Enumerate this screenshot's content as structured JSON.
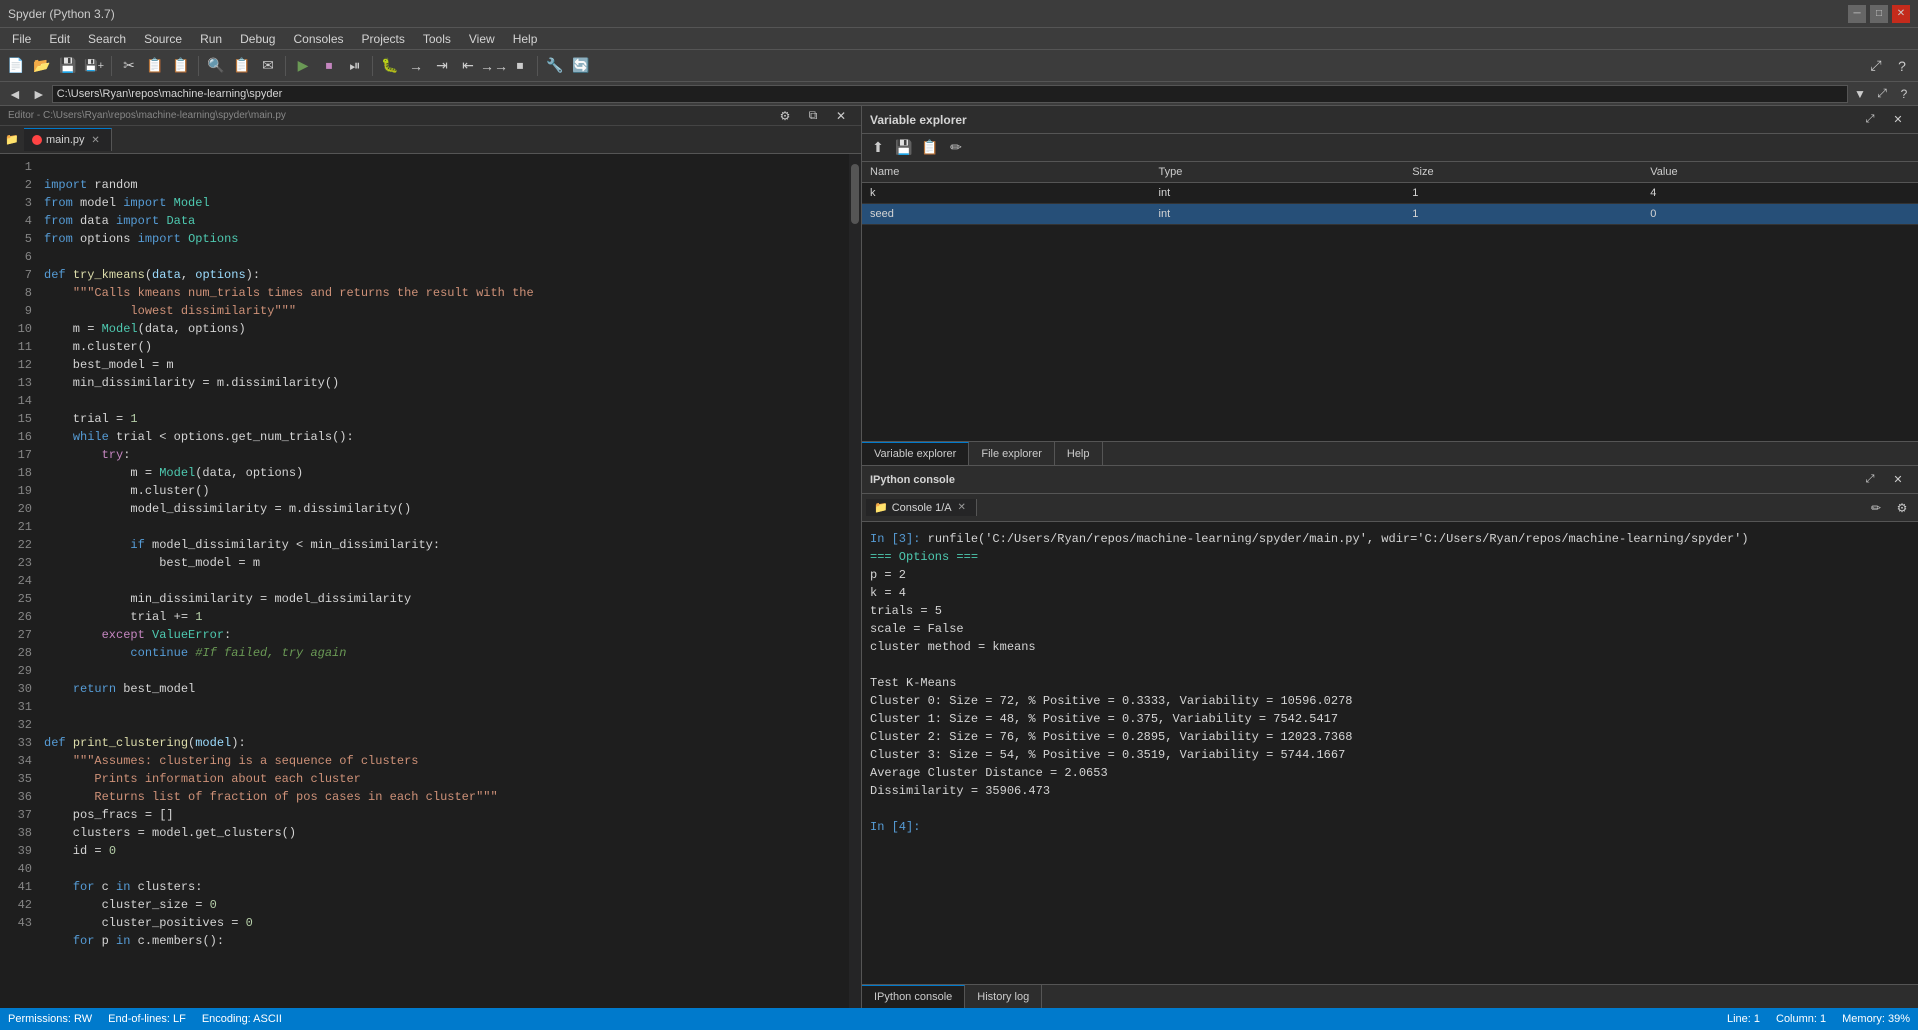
{
  "titleBar": {
    "title": "Spyder (Python 3.7)",
    "minimizeLabel": "─",
    "maximizeLabel": "□",
    "closeLabel": "✕"
  },
  "menuBar": {
    "items": [
      "File",
      "Edit",
      "Search",
      "Source",
      "Run",
      "Debug",
      "Consoles",
      "Projects",
      "Tools",
      "View",
      "Help"
    ]
  },
  "toolbar": {
    "buttons": [
      "📄",
      "📂",
      "💾",
      "✂",
      "📋",
      "📋",
      "🔍",
      "📋",
      "✉",
      "▶",
      "⏹",
      "⏯",
      "⏭",
      "🔧",
      "↺",
      "→",
      "⇥",
      "⇤",
      "→→",
      "⏹",
      "⏸",
      "◼",
      "🔧",
      "🔄"
    ]
  },
  "navBar": {
    "backLabel": "◄",
    "forwardLabel": "►",
    "path": "C:\\Users\\Ryan\\repos\\machine-learning\\spyder",
    "browseLabel": "▼"
  },
  "editor": {
    "headerLeft": "Editor - C:\\Users\\Ryan\\repos\\machine-learning\\spyder\\main.py",
    "tabs": [
      {
        "name": "main.py",
        "active": true,
        "modified": true
      }
    ],
    "gearIcon": "⚙",
    "closeIcon": "✕",
    "lines": [
      {
        "num": 1,
        "text": "import random"
      },
      {
        "num": 2,
        "text": "from model import Model"
      },
      {
        "num": 3,
        "text": "from data import Data"
      },
      {
        "num": 4,
        "text": "from options import Options"
      },
      {
        "num": 5,
        "text": ""
      },
      {
        "num": 6,
        "text": "def try_kmeans(data, options):"
      },
      {
        "num": 7,
        "text": "    \"\"\"Calls kmeans num_trials times and returns the result with the"
      },
      {
        "num": 8,
        "text": "            lowest dissimilarity\"\"\""
      },
      {
        "num": 9,
        "text": "    m = Model(data, options)"
      },
      {
        "num": 10,
        "text": "    m.cluster()"
      },
      {
        "num": 11,
        "text": "    best_model = m"
      },
      {
        "num": 12,
        "text": "    min_dissimilarity = m.dissimilarity()"
      },
      {
        "num": 13,
        "text": ""
      },
      {
        "num": 14,
        "text": "    trial = 1"
      },
      {
        "num": 15,
        "text": "    while trial < options.get_num_trials():"
      },
      {
        "num": 16,
        "text": "        try:"
      },
      {
        "num": 17,
        "text": "            m = Model(data, options)"
      },
      {
        "num": 18,
        "text": "            m.cluster()"
      },
      {
        "num": 19,
        "text": "            model_dissimilarity = m.dissimilarity()"
      },
      {
        "num": 20,
        "text": ""
      },
      {
        "num": 21,
        "text": "            if model_dissimilarity < min_dissimilarity:"
      },
      {
        "num": 22,
        "text": "                best_model = m"
      },
      {
        "num": 23,
        "text": ""
      },
      {
        "num": 24,
        "text": "            min_dissimilarity = model_dissimilarity"
      },
      {
        "num": 25,
        "text": "            trial += 1"
      },
      {
        "num": 26,
        "text": "        except ValueError:"
      },
      {
        "num": 27,
        "text": "            continue #If failed, try again"
      },
      {
        "num": 28,
        "text": ""
      },
      {
        "num": 29,
        "text": "    return best_model"
      },
      {
        "num": 30,
        "text": ""
      },
      {
        "num": 31,
        "text": ""
      },
      {
        "num": 32,
        "text": "def print_clustering(model):"
      },
      {
        "num": 33,
        "text": "    \"\"\"Assumes: clustering is a sequence of clusters"
      },
      {
        "num": 34,
        "text": "       Prints information about each cluster"
      },
      {
        "num": 35,
        "text": "       Returns list of fraction of pos cases in each cluster\"\"\""
      },
      {
        "num": 36,
        "text": "    pos_fracs = []"
      },
      {
        "num": 37,
        "text": "    clusters = model.get_clusters()"
      },
      {
        "num": 38,
        "text": "    id = 0"
      },
      {
        "num": 39,
        "text": ""
      },
      {
        "num": 40,
        "text": "    for c in clusters:"
      },
      {
        "num": 41,
        "text": "        cluster_size = 0"
      },
      {
        "num": 42,
        "text": "        cluster_positives = 0"
      },
      {
        "num": 43,
        "text": "    for p in c.members():"
      }
    ]
  },
  "variableExplorer": {
    "title": "Variable explorer",
    "gearIcon": "⚙",
    "closeIcon": "✕",
    "expandIcon": "⤢",
    "toolbarIcons": [
      "⬆",
      "📋",
      "📋",
      "✏"
    ],
    "columns": [
      "Name",
      "Type",
      "Size",
      "Value"
    ],
    "rows": [
      {
        "name": "k",
        "type": "int",
        "size": "1",
        "value": "4",
        "selected": false
      },
      {
        "name": "seed",
        "type": "int",
        "size": "1",
        "value": "0",
        "selected": true
      }
    ],
    "tabs": [
      "Variable explorer",
      "File explorer",
      "Help"
    ]
  },
  "console": {
    "title": "IPython console",
    "expandIcon": "⤢",
    "closeIcon": "✕",
    "consoleTabs": [
      {
        "name": "Console 1/A",
        "active": true
      }
    ],
    "toolbarIcons": [
      "📁",
      "✏",
      "⚙"
    ],
    "output": [
      {
        "type": "in",
        "text": "In [3]: runfile('C:/Users/Ryan/repos/machine-learning/spyder/main.py', wdir='C:/Users/Ryan/repos/machine-learning/spyder')"
      },
      {
        "type": "out",
        "text": "=== Options ==="
      },
      {
        "type": "out",
        "text": "p = 2"
      },
      {
        "type": "out",
        "text": "k = 4"
      },
      {
        "type": "out",
        "text": "trials = 5"
      },
      {
        "type": "out",
        "text": "scale = False"
      },
      {
        "type": "out",
        "text": "cluster method = kmeans"
      },
      {
        "type": "out",
        "text": ""
      },
      {
        "type": "out",
        "text": "Test K-Means"
      },
      {
        "type": "out",
        "text": "Cluster 0: Size = 72, % Positive = 0.3333, Variability = 10596.0278"
      },
      {
        "type": "out",
        "text": "Cluster 1: Size = 48, % Positive = 0.375, Variability = 7542.5417"
      },
      {
        "type": "out",
        "text": "Cluster 2: Size = 76, % Positive = 0.2895, Variability = 12023.7368"
      },
      {
        "type": "out",
        "text": "Cluster 3: Size = 54, % Positive = 0.3519, Variability = 5744.1667"
      },
      {
        "type": "out",
        "text": "Average Cluster Distance = 2.0653"
      },
      {
        "type": "out",
        "text": "Dissimilarity = 35906.473"
      },
      {
        "type": "out",
        "text": ""
      },
      {
        "type": "in-prompt",
        "text": "In [4]:"
      }
    ],
    "bottomTabs": [
      "IPython console",
      "History log"
    ]
  },
  "statusBar": {
    "permissions": "Permissions: RW",
    "lineEndings": "End-of-lines: LF",
    "encoding": "Encoding: ASCII",
    "line": "Line: 1",
    "column": "Column: 1",
    "memory": "Memory: 39%"
  }
}
